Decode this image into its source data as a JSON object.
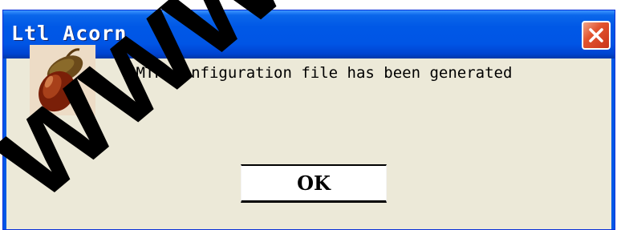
{
  "window": {
    "title": "Ltl Acorn"
  },
  "titlebar": {
    "close_icon": "close-x-icon",
    "close_color": "#d8472a"
  },
  "dialog": {
    "icon": "acorn-icon",
    "message": "SMTP configuration file has been generated",
    "ok_label": "OK"
  },
  "watermark": {
    "text": "www",
    "color": "#000000"
  }
}
